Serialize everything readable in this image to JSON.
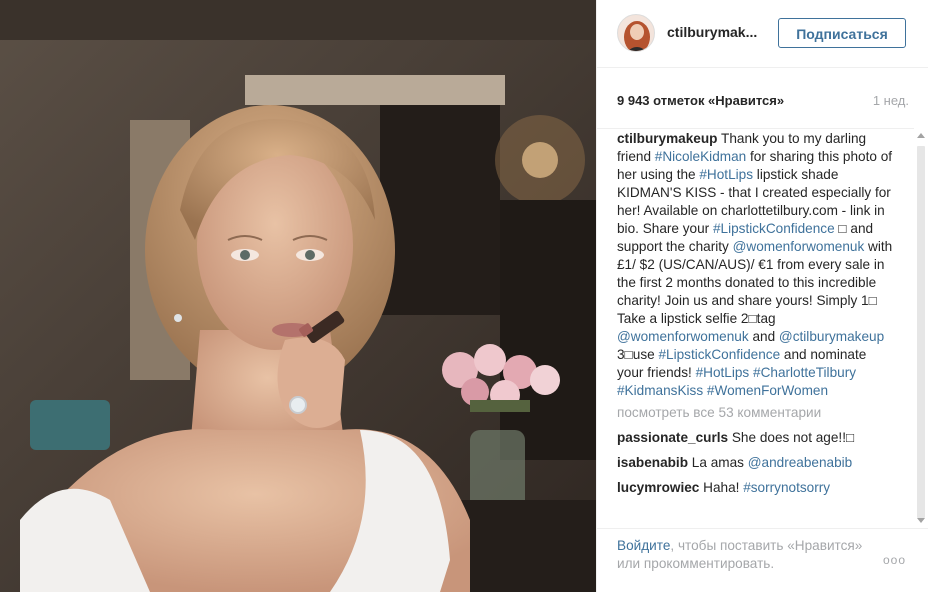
{
  "post": {
    "username": "ctilburymakeup",
    "username_display": "ctilburymak...",
    "follow_label": "Подписаться",
    "likes": "9 943 отметок «Нравится»",
    "time": "1 нед."
  },
  "caption": {
    "user": "ctilburymakeup",
    "t1": " Thank you to my darling friend ",
    "tag_nicole": "#NicoleKidman",
    "t2": " for sharing this photo of her using the ",
    "tag_hotlips": "#HotLips",
    "t3": " lipstick shade KIDMAN'S KISS - that I created especially for her! Available on charlottetilbury.com - link in bio. Share your ",
    "tag_confidence": "#LipstickConfidence",
    "t4": " □ and support the charity ",
    "mention_wfw": "@womenforwomenuk",
    "t5": " with £1/ $2 (US/CAN/AUS)/ €1 from every sale in the first 2 months donated to this incredible charity! Join us and share yours! Simply 1□ Take a lipstick selfie 2□tag ",
    "mention_wfw2": "@womenforwomenuk",
    "t6": " and ",
    "mention_ct": "@ctilburymakeup",
    "t7": " 3□use ",
    "tag_confidence2": "#LipstickConfidence",
    "t8": " and nominate your friends! ",
    "tag_hotlips2": "#HotLips",
    "t9": " ",
    "tag_ct": "#CharlotteTilbury",
    "t10": " ",
    "tag_kk": "#KidmansKiss",
    "t11": " ",
    "tag_wfw": "#WomenForWomen"
  },
  "view_all": "посмотреть все 53 комментарии",
  "comments": [
    {
      "user": "passionate_curls",
      "text": " She does not age!!□"
    },
    {
      "user": "isabenabib",
      "text": " La amas ",
      "link": "@andreabenabib"
    },
    {
      "user": "lucymrowiec",
      "text": " Haha! ",
      "link": "#sorrynotsorry"
    }
  ],
  "footer": {
    "login": "Войдите",
    "rest": ", чтобы поставить «Нравится» или прокомментировать.",
    "more": "ooo"
  },
  "colors": {
    "link": "#3f729b",
    "muted": "#a5a7aa",
    "text": "#262626"
  }
}
